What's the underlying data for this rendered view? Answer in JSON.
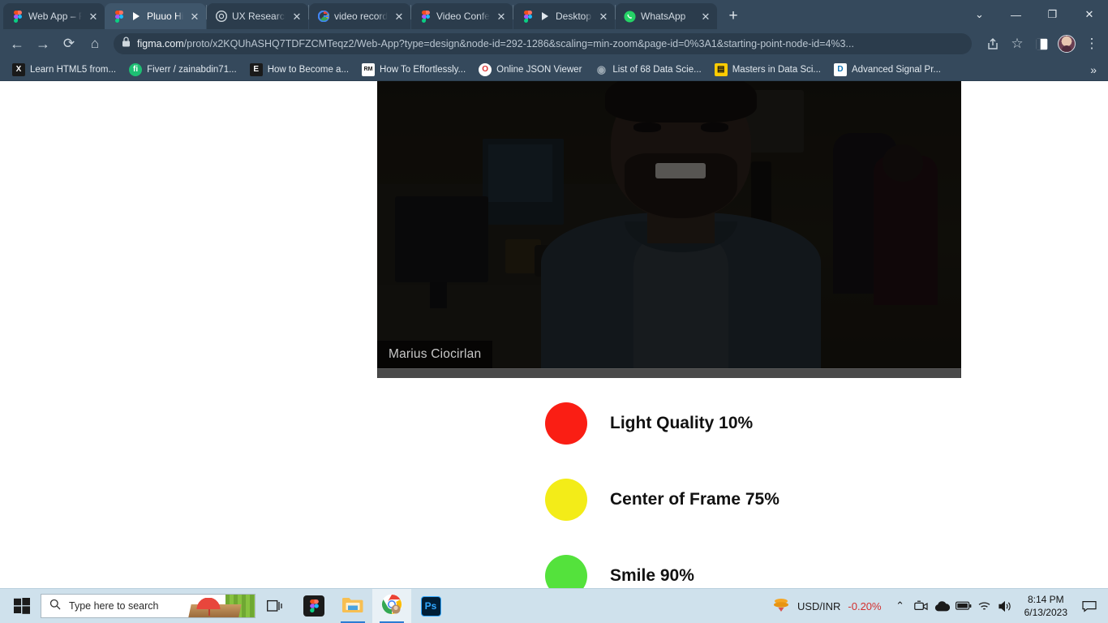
{
  "browser": {
    "tabs": [
      {
        "title": "Web App – Figma",
        "favicon": "figma-icon",
        "active": false,
        "playing": false
      },
      {
        "title": "Pluuo HiFi - We",
        "favicon": "figma-icon",
        "active": true,
        "playing": true
      },
      {
        "title": "UX Research Guid",
        "favicon": "openai-icon",
        "active": false,
        "playing": false
      },
      {
        "title": "video recording u",
        "favicon": "google-icon",
        "active": false,
        "playing": false
      },
      {
        "title": "Video Conferenci",
        "favicon": "figma-icon",
        "active": false,
        "playing": false
      },
      {
        "title": "Desktop - Vi",
        "favicon": "figma-icon",
        "active": false,
        "playing": true
      },
      {
        "title": "WhatsApp",
        "favicon": "whatsapp-icon",
        "active": false,
        "playing": false
      }
    ],
    "new_tab_label": "+",
    "tab_close_label": "✕",
    "window_controls": {
      "tab_search": "⌄",
      "minimize": "—",
      "maximize": "❐",
      "close": "✕"
    },
    "toolbar": {
      "back": "←",
      "forward": "→",
      "reload": "⟳",
      "home": "⌂",
      "url_domain": "figma.com",
      "url_path": "/proto/x2KQUhASHQ7TDFZCMTeqz2/Web-App?type=design&node-id=292-1286&scaling=min-zoom&page-id=0%3A1&starting-point-node-id=4%3...",
      "share": "share-icon",
      "bookmark": "☆",
      "sidepanel": "▯",
      "menu": "⋮"
    },
    "bookmarks": [
      {
        "label": "Learn HTML5 from...",
        "icon": "X",
        "icon_bg": "#1a1a1a",
        "icon_color": "#ffffff"
      },
      {
        "label": "Fiverr / zainabdin71...",
        "icon": "fi",
        "icon_bg": "#1dbf73",
        "icon_color": "#ffffff"
      },
      {
        "label": "How to Become a...",
        "icon": "E",
        "icon_bg": "#1a1a1a",
        "icon_color": "#ffffff"
      },
      {
        "label": "How To Effortlessly...",
        "icon": "RM",
        "icon_bg": "#ffffff",
        "icon_color": "#111111"
      },
      {
        "label": "Online JSON Viewer",
        "icon": "O",
        "icon_bg": "#d33",
        "icon_color": "#ffffff"
      },
      {
        "label": "List of 68 Data Scie...",
        "icon": "◉",
        "icon_bg": "#7a7a7a",
        "icon_color": "#ffffff"
      },
      {
        "label": "Masters in Data Sci...",
        "icon": "▤",
        "icon_bg": "#ffcc00",
        "icon_color": "#111111"
      },
      {
        "label": "Advanced Signal Pr...",
        "icon": "D",
        "icon_bg": "#ffffff",
        "icon_color": "#0b72b5"
      }
    ],
    "bookmarks_overflow": "»"
  },
  "page": {
    "video": {
      "participant_name": "Marius Ciocirlan",
      "scene_description": "smiling-man-office-video"
    },
    "metrics": [
      {
        "label": "Light Quality 10%",
        "value": 10,
        "color": "#fa1e14",
        "name": "light-quality"
      },
      {
        "label": "Center of Frame 75%",
        "value": 75,
        "color": "#f3ec18",
        "name": "center-of-frame"
      },
      {
        "label": "Smile 90%",
        "value": 90,
        "color": "#54e23c",
        "name": "smile"
      }
    ]
  },
  "taskbar": {
    "start_label": "start-icon",
    "search_placeholder": "Type here to search",
    "apps": [
      {
        "name": "task-view",
        "label": "▯|"
      },
      {
        "name": "figma",
        "label": "figma-icon"
      },
      {
        "name": "file-explorer",
        "label": "folder-icon"
      },
      {
        "name": "google-chrome",
        "label": "chrome-icon"
      },
      {
        "name": "photoshop",
        "label": "Ps"
      }
    ],
    "tray": {
      "stock_name": "USD/INR",
      "stock_change": "-0.20%",
      "show_hidden": "⌃",
      "time": "8:14 PM",
      "date": "6/13/2023",
      "notification": "notification-icon"
    }
  }
}
